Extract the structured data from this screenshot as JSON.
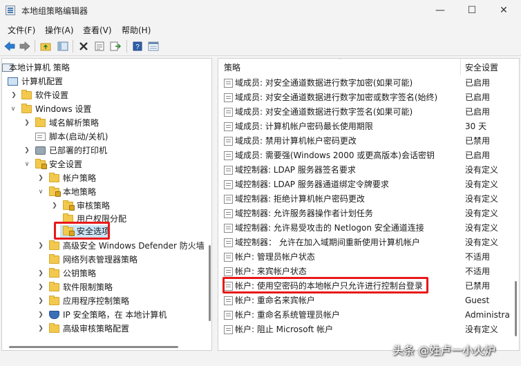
{
  "window": {
    "title": "本地组策略编辑器",
    "minimize": "—",
    "maximize": "☐",
    "close": "✕"
  },
  "menu": [
    "文件(F)",
    "操作(A)",
    "查看(V)",
    "帮助(H)"
  ],
  "toolbar_icons": [
    "back-arrow-icon",
    "forward-arrow-icon",
    "up-folder-icon",
    "show-tree-icon",
    "delete-icon",
    "properties-icon",
    "export-list-icon",
    "help-icon",
    "view-icon"
  ],
  "tree": {
    "items": [
      {
        "label": "本地计算机 策略"
      },
      {
        "label": "计算机配置"
      },
      {
        "label": "软件设置"
      },
      {
        "label": "Windows 设置"
      },
      {
        "label": "域名解析策略"
      },
      {
        "label": "脚本(启动/关机)"
      },
      {
        "label": "已部署的打印机"
      },
      {
        "label": "安全设置"
      },
      {
        "label": "帐户策略"
      },
      {
        "label": "本地策略"
      },
      {
        "label": "审核策略"
      },
      {
        "label": "用户权限分配"
      },
      {
        "label": "安全选项"
      },
      {
        "label": "高级安全 Windows Defender 防火墙"
      },
      {
        "label": "网络列表管理器策略"
      },
      {
        "label": "公钥策略"
      },
      {
        "label": "软件限制策略"
      },
      {
        "label": "应用程序控制策略"
      },
      {
        "label": "IP 安全策略，在 本地计算机"
      },
      {
        "label": "高级审核策略配置"
      }
    ],
    "selected": "安全选项"
  },
  "list": {
    "columns": {
      "policy": "策略",
      "setting": "安全设置"
    },
    "rows": [
      {
        "policy": "域成员: 对安全通道数据进行数字加密(如果可能)",
        "setting": "已启用"
      },
      {
        "policy": "域成员: 对安全通道数据进行数字加密或数字签名(始终)",
        "setting": "已启用"
      },
      {
        "policy": "域成员: 对安全通道数据进行数字签名(如果可能)",
        "setting": "已启用"
      },
      {
        "policy": "域成员: 计算机帐户密码最长使用期限",
        "setting": "30 天"
      },
      {
        "policy": "域成员: 禁用计算机帐户密码更改",
        "setting": "已禁用"
      },
      {
        "policy": "域成员: 需要强(Windows 2000 或更高版本)会话密钥",
        "setting": "已启用"
      },
      {
        "policy": "域控制器: LDAP 服务器签名要求",
        "setting": "没有定义"
      },
      {
        "policy": "域控制器: LDAP 服务器通道绑定令牌要求",
        "setting": "没有定义"
      },
      {
        "policy": "域控制器: 拒绝计算机帐户密码更改",
        "setting": "没有定义"
      },
      {
        "policy": "域控制器: 允许服务器操作者计划任务",
        "setting": "没有定义"
      },
      {
        "policy": "域控制器: 允许易受攻击的 Netlogon 安全通道连接",
        "setting": "没有定义"
      },
      {
        "policy": "域控制器：  允许在加入域期间重新使用计算机帐户",
        "setting": "没有定义"
      },
      {
        "policy": "帐户: 管理员帐户状态",
        "setting": "不适用"
      },
      {
        "policy": "帐户: 来宾帐户状态",
        "setting": "不适用"
      },
      {
        "policy": "帐户: 使用空密码的本地帐户只允许进行控制台登录",
        "setting": "已禁用"
      },
      {
        "policy": "帐户: 重命名来宾帐户",
        "setting": "Guest"
      },
      {
        "policy": "帐户: 重命名系统管理员帐户",
        "setting": "Administra"
      },
      {
        "policy": "帐户: 阻止 Microsoft 帐户",
        "setting": "没有定义"
      }
    ]
  },
  "watermark": "头条 @姓卢一小火炉",
  "colors": {
    "highlight_border": "#e81818",
    "selection": "#cce4f7"
  }
}
